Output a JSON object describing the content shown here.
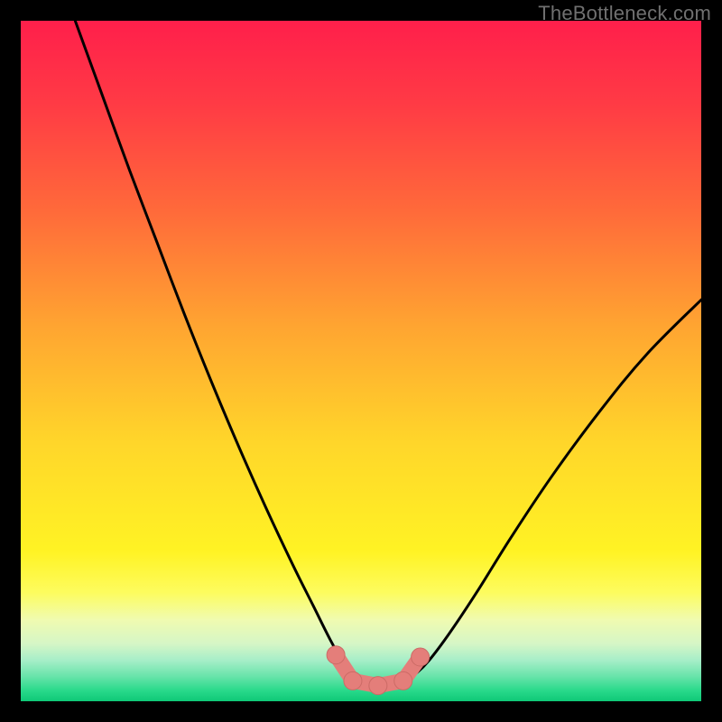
{
  "watermark": "TheBottleneck.com",
  "colors": {
    "frame": "#000000",
    "gradient_stops": [
      {
        "offset": 0.0,
        "color": "#ff1f4b"
      },
      {
        "offset": 0.12,
        "color": "#ff3a45"
      },
      {
        "offset": 0.28,
        "color": "#ff6a3a"
      },
      {
        "offset": 0.45,
        "color": "#ffa531"
      },
      {
        "offset": 0.62,
        "color": "#ffd62a"
      },
      {
        "offset": 0.78,
        "color": "#fff324"
      },
      {
        "offset": 0.84,
        "color": "#fdfc5e"
      },
      {
        "offset": 0.88,
        "color": "#f0fbb0"
      },
      {
        "offset": 0.915,
        "color": "#d6f6c6"
      },
      {
        "offset": 0.94,
        "color": "#a6eec8"
      },
      {
        "offset": 0.965,
        "color": "#64e3a8"
      },
      {
        "offset": 0.985,
        "color": "#27d98a"
      },
      {
        "offset": 1.0,
        "color": "#0fc877"
      }
    ],
    "curve_stroke": "#000000",
    "marker_fill": "#e47e7a",
    "marker_stroke": "#cc6b66"
  },
  "chart_data": {
    "type": "line",
    "title": "",
    "xlabel": "",
    "ylabel": "",
    "xlim": [
      0,
      100
    ],
    "ylim": [
      0,
      100
    ],
    "note": "Axes are implicit (no ticks shown); values are estimated from pixel positions within the 754×754 plot area, normalized to 0–100.",
    "series": [
      {
        "name": "left-curve",
        "type": "line",
        "points": [
          {
            "x": 8.0,
            "y": 100.0
          },
          {
            "x": 12.0,
            "y": 89.0
          },
          {
            "x": 16.0,
            "y": 78.0
          },
          {
            "x": 20.0,
            "y": 67.5
          },
          {
            "x": 24.0,
            "y": 57.0
          },
          {
            "x": 28.0,
            "y": 47.0
          },
          {
            "x": 32.0,
            "y": 37.5
          },
          {
            "x": 36.0,
            "y": 28.5
          },
          {
            "x": 40.0,
            "y": 20.0
          },
          {
            "x": 43.0,
            "y": 14.0
          },
          {
            "x": 45.5,
            "y": 9.0
          },
          {
            "x": 47.5,
            "y": 5.5
          },
          {
            "x": 49.0,
            "y": 3.5
          },
          {
            "x": 50.0,
            "y": 2.5
          }
        ]
      },
      {
        "name": "right-curve",
        "type": "line",
        "points": [
          {
            "x": 56.0,
            "y": 2.5
          },
          {
            "x": 58.0,
            "y": 4.0
          },
          {
            "x": 60.0,
            "y": 6.0
          },
          {
            "x": 63.0,
            "y": 10.0
          },
          {
            "x": 67.0,
            "y": 16.0
          },
          {
            "x": 72.0,
            "y": 24.0
          },
          {
            "x": 78.0,
            "y": 33.0
          },
          {
            "x": 85.0,
            "y": 42.5
          },
          {
            "x": 92.0,
            "y": 51.0
          },
          {
            "x": 100.0,
            "y": 59.0
          }
        ]
      },
      {
        "name": "trough-markers",
        "type": "scatter",
        "points": [
          {
            "x": 46.3,
            "y": 6.8
          },
          {
            "x": 48.8,
            "y": 3.0
          },
          {
            "x": 52.5,
            "y": 2.3
          },
          {
            "x": 56.2,
            "y": 3.0
          },
          {
            "x": 58.7,
            "y": 6.5
          }
        ]
      }
    ]
  }
}
